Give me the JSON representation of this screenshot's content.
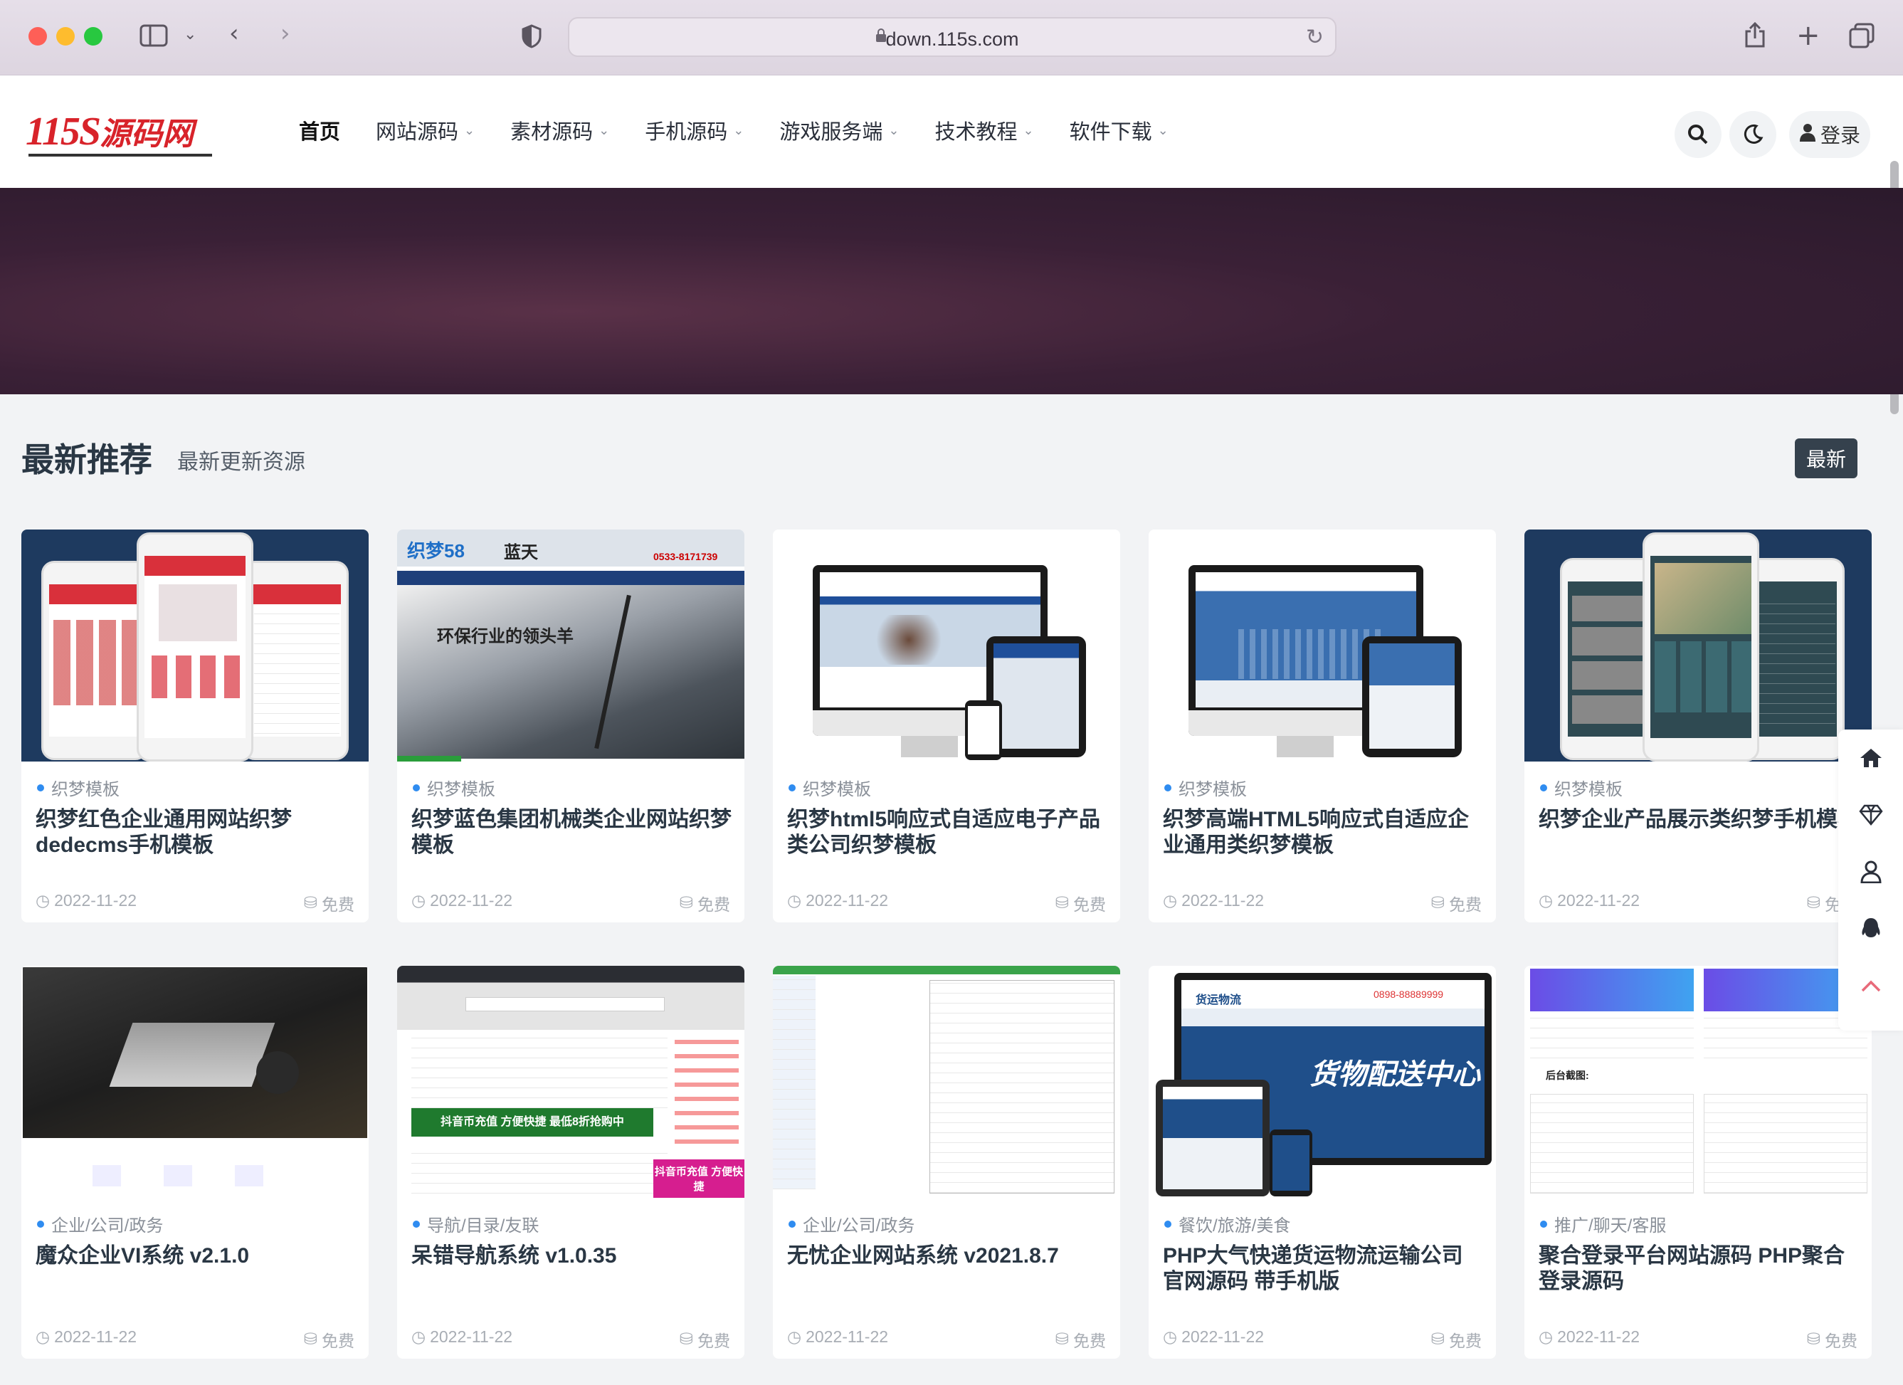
{
  "browser": {
    "url": "down.115s.com"
  },
  "site": {
    "logo_latin": "115S",
    "logo_cn": "源码网",
    "nav": [
      {
        "label": "首页",
        "active": true
      },
      {
        "label": "网站源码"
      },
      {
        "label": "素材源码"
      },
      {
        "label": "手机源码"
      },
      {
        "label": "游戏服务端"
      },
      {
        "label": "技术教程"
      },
      {
        "label": "软件下载"
      }
    ],
    "login_label": "登录"
  },
  "section": {
    "title": "最新推荐",
    "subtitle": "最新更新资源",
    "sort_button": "最新"
  },
  "cards": [
    {
      "category": "织梦模板",
      "title": "织梦红色企业通用网站织梦dedecms手机模板",
      "date": "2022-11-22",
      "price": "免费"
    },
    {
      "category": "织梦模板",
      "title": "织梦蓝色集团机械类企业网站织梦模板",
      "date": "2022-11-22",
      "price": "免费"
    },
    {
      "category": "织梦模板",
      "title": "织梦html5响应式自适应电子产品类公司织梦模板",
      "date": "2022-11-22",
      "price": "免费"
    },
    {
      "category": "织梦模板",
      "title": "织梦高端HTML5响应式自适应企业通用类织梦模板",
      "date": "2022-11-22",
      "price": "免费"
    },
    {
      "category": "织梦模板",
      "title": "织梦企业产品展示类织梦手机模板",
      "date": "2022-11-22",
      "price": "免费"
    },
    {
      "category": "企业/公司/政务",
      "title": "魔众企业VI系统 v2.1.0",
      "date": "2022-11-22",
      "price": "免费"
    },
    {
      "category": "导航/目录/友联",
      "title": "呆错导航系统 v1.0.35",
      "date": "2022-11-22",
      "price": "免费"
    },
    {
      "category": "企业/公司/政务",
      "title": "无忧企业网站系统 v2021.8.7",
      "date": "2022-11-22",
      "price": "免费"
    },
    {
      "category": "餐饮/旅游/美食",
      "title": "PHP大气快递货运物流运输公司官网源码 带手机版",
      "date": "2022-11-22",
      "price": "免费"
    },
    {
      "category": "推广/聊天/客服",
      "title": "聚合登录平台网站源码 PHP聚合登录源码",
      "date": "2022-11-22",
      "price": "免费"
    }
  ],
  "thumb_text": {
    "c2_brand": "织梦58",
    "c2_brand2": "蓝天",
    "c2_phone": "0533-8171739",
    "c2_slogan": "环保行业的领头羊",
    "c7_promo": "抖音币充值 方便快捷 最低8折抢购中",
    "c7_badge": "抖音币充值 方便快捷",
    "c9_brand": "货运物流",
    "c9_phone": "0898-88889999",
    "c9_slogan": "货物配送中心",
    "c10_label": "后台截图:"
  }
}
